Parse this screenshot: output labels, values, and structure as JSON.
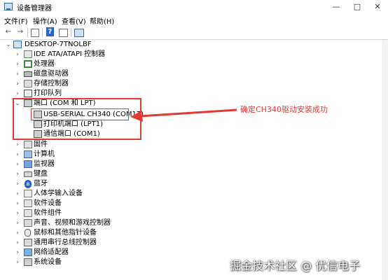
{
  "window": {
    "title": "设备管理器"
  },
  "menu": [
    "文件(F)",
    "操作(A)",
    "查看(V)",
    "帮助(H)"
  ],
  "tree": {
    "root": "DESKTOP-7TNOLBF",
    "items": [
      {
        "label": "IDE ATA/ATAPI 控制器",
        "icon": "ide-controller-icon"
      },
      {
        "label": "处理器",
        "icon": "processor-icon"
      },
      {
        "label": "磁盘驱动器",
        "icon": "disk-drive-icon"
      },
      {
        "label": "存储控制器",
        "icon": "storage-controller-icon"
      },
      {
        "label": "打印队列",
        "icon": "printer-icon"
      },
      {
        "label": "端口 (COM 和 LPT)",
        "icon": "port-icon",
        "children": [
          {
            "label": "USB-SERIAL CH340 (COM17)",
            "icon": "port-icon"
          },
          {
            "label": "打印机端口 (LPT1)",
            "icon": "port-icon"
          },
          {
            "label": "通信端口 (COM1)",
            "icon": "port-icon"
          }
        ]
      },
      {
        "label": "固件",
        "icon": "firmware-icon"
      },
      {
        "label": "计算机",
        "icon": "computer-icon"
      },
      {
        "label": "监视器",
        "icon": "monitor-icon"
      },
      {
        "label": "键盘",
        "icon": "keyboard-icon"
      },
      {
        "label": "蓝牙",
        "icon": "bluetooth-icon"
      },
      {
        "label": "人体学输入设备",
        "icon": "hid-icon"
      },
      {
        "label": "软件设备",
        "icon": "software-device-icon"
      },
      {
        "label": "软件组件",
        "icon": "software-component-icon"
      },
      {
        "label": "声音、视频和游戏控制器",
        "icon": "sound-icon"
      },
      {
        "label": "鼠标和其他指针设备",
        "icon": "mouse-icon"
      },
      {
        "label": "通用串行总线控制器",
        "icon": "usb-icon"
      },
      {
        "label": "网络适配器",
        "icon": "network-adapter-icon"
      },
      {
        "label": "系统设备",
        "icon": "system-device-icon"
      }
    ]
  },
  "annotation": {
    "text": "确定CH340驱动安装成功",
    "color": "#e53935"
  },
  "watermark": "掘金技术社区 @ 优信电子"
}
